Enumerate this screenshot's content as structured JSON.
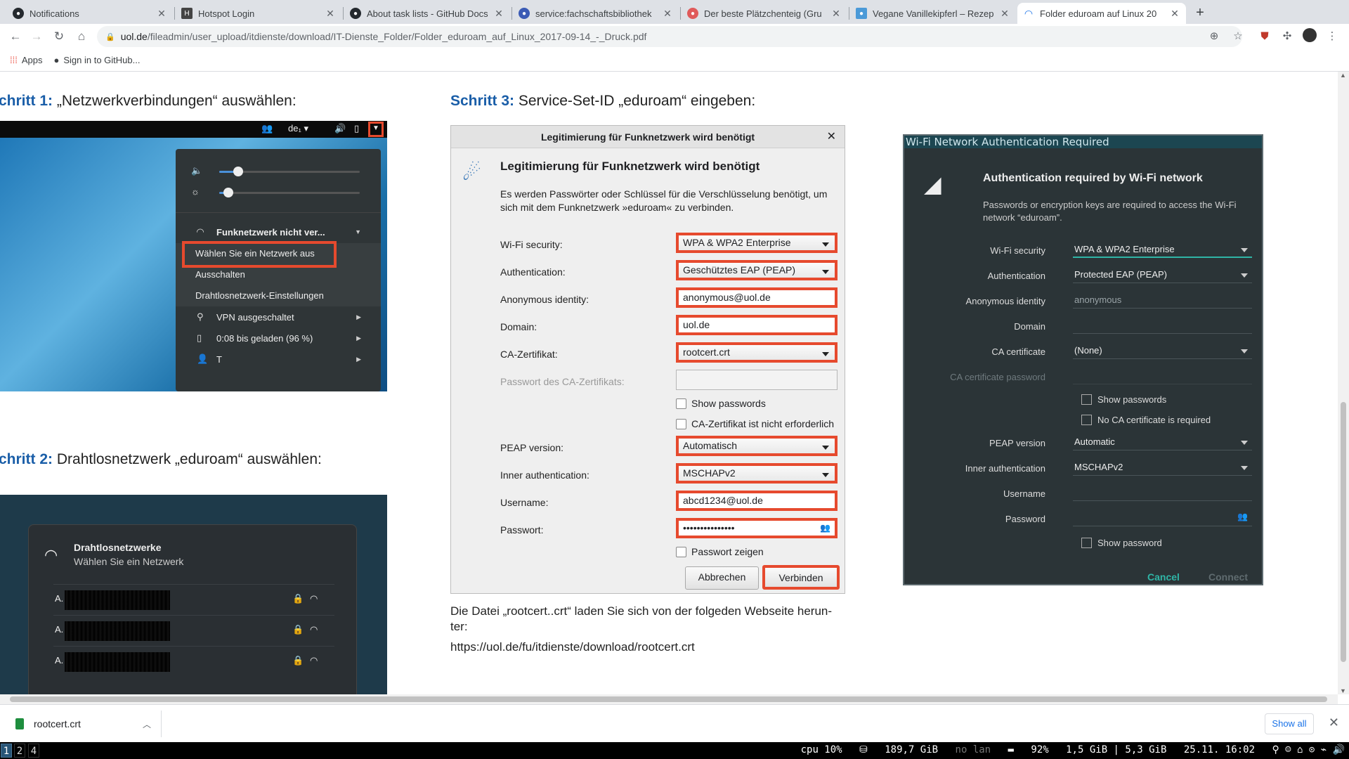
{
  "browser": {
    "tabs": [
      {
        "title": "Notifications",
        "icon": "github-icon"
      },
      {
        "title": "Hotspot Login",
        "icon": "h5-icon"
      },
      {
        "title": "About task lists - GitHub Docs",
        "icon": "github-icon"
      },
      {
        "title": "service:fachschaftsbibliothek",
        "icon": "wiki-icon"
      },
      {
        "title": "Der beste Plätzchenteig (Gru",
        "icon": "recipe-icon"
      },
      {
        "title": "Vegane Vanillekipferl – Rezep",
        "icon": "recipe-icon"
      },
      {
        "title": "Folder eduroam auf Linux 20",
        "icon": "loading-icon"
      }
    ],
    "url_host": "uol.de",
    "url_path": "/fileadmin/user_upload/itdienste/download/IT-Dienste_Folder/Folder_eduroam_auf_Linux_2017-09-14_-_Druck.pdf",
    "bookmarks": [
      {
        "label": "Apps",
        "icon": "apps-grid-icon"
      },
      {
        "label": "Sign in to GitHub...",
        "icon": "github-icon"
      }
    ]
  },
  "doc": {
    "step1": {
      "num": "chritt 1:",
      "text": " „Netzwerkverbindungen“ auswählen:"
    },
    "step2": {
      "num": "chritt 2:",
      "text": " Drahtlosnetzwerk „eduroam“ auswählen:"
    },
    "step3": {
      "num": "Schritt 3:",
      "text": " Service-Set-ID „eduroam“ eingeben:"
    },
    "gnome_menu": {
      "keyboard": "de₁",
      "network": "Funknetzwerk nicht ver...",
      "items": [
        "Wählen Sie ein Netzwerk aus",
        "Ausschalten",
        "Drahtlosnetzwerk-Einstellungen"
      ],
      "vpn": "VPN ausgeschaltet",
      "battery": "0:08 bis geladen (96 %)",
      "user": "T"
    },
    "wifi_list": {
      "title": "Drahtlosnetzwerke",
      "subtitle": "Wählen Sie ein Netzwerk",
      "rows": [
        "A.",
        "A.",
        "A."
      ]
    },
    "kde_dialog": {
      "window_title": "Legitimierung für Funknetzwerk wird benötigt",
      "heading": "Legitimierung für Funknetzwerk wird benötigt",
      "description": "Es werden Passwörter oder Schlüssel für die Verschlüsselung benötigt, um sich mit dem Funknetzwerk »eduroam« zu verbinden.",
      "labels": {
        "security": "Wi-Fi security:",
        "auth": "Authentication:",
        "anon": "Anonymous identity:",
        "domain": "Domain:",
        "ca": "CA-Zertifikat:",
        "ca_pw": "Passwort des CA-Zertifikats:",
        "peap": "PEAP version:",
        "inner": "Inner authentication:",
        "user": "Username:",
        "pw": "Passwort:"
      },
      "values": {
        "security": "WPA & WPA2 Enterprise",
        "auth": "Geschütztes EAP (PEAP)",
        "anon": "anonymous@uol.de",
        "domain": "uol.de",
        "ca": "rootcert.crt",
        "peap": "Automatisch",
        "inner": "MSCHAPv2",
        "user": "abcd1234@uol.de",
        "pw": "•••••••••••••••"
      },
      "checks": {
        "show_pw": "Show passwords",
        "no_ca": "CA-Zertifikat ist nicht erforderlich",
        "show_pw2": "Passwort zeigen"
      },
      "cancel": "Abbrechen",
      "connect": "Verbinden"
    },
    "dark_dialog": {
      "window_title": "Wi-Fi Network Authentication Required",
      "heading": "Authentication required by Wi-Fi network",
      "description": "Passwords or encryption keys are required to access the Wi-Fi network “eduroam”.",
      "labels": {
        "security": "Wi-Fi security",
        "auth": "Authentication",
        "anon": "Anonymous identity",
        "domain": "Domain",
        "ca": "CA certificate",
        "ca_pw": "CA certificate password",
        "peap": "PEAP version",
        "inner": "Inner authentication",
        "user": "Username",
        "pw": "Password"
      },
      "values": {
        "security": "WPA & WPA2 Enterprise",
        "auth": "Protected EAP (PEAP)",
        "anon": "anonymous",
        "ca": "(None)",
        "peap": "Automatic",
        "inner": "MSCHAPv2"
      },
      "checks": {
        "show_pw": "Show passwords",
        "no_ca": "No CA certificate is required",
        "show_pw2": "Show password"
      },
      "cancel": "Cancel",
      "connect": "Connect"
    },
    "rootcert_text": "Die Datei „rootcert..crt“ laden Sie sich von der folgeden Webseite herun-\nter:",
    "rootcert_url": "https://uol.de/fu/itdienste/download/rootcert.crt"
  },
  "downloads": {
    "file": "rootcert.crt",
    "show_all": "Show all"
  },
  "i3bar": {
    "workspaces": [
      "1",
      "2",
      "4"
    ],
    "cpu": "cpu  10%",
    "disk": "189,7 GiB",
    "lan": "no lan",
    "battery": "92%",
    "mem": "1,5 GiB | 5,3 GiB",
    "datetime": "25.11. 16:02"
  },
  "colors": {
    "highlight": "#e64a2e",
    "step_blue": "#1a5ea8",
    "accent_teal": "#2fb5a6"
  }
}
